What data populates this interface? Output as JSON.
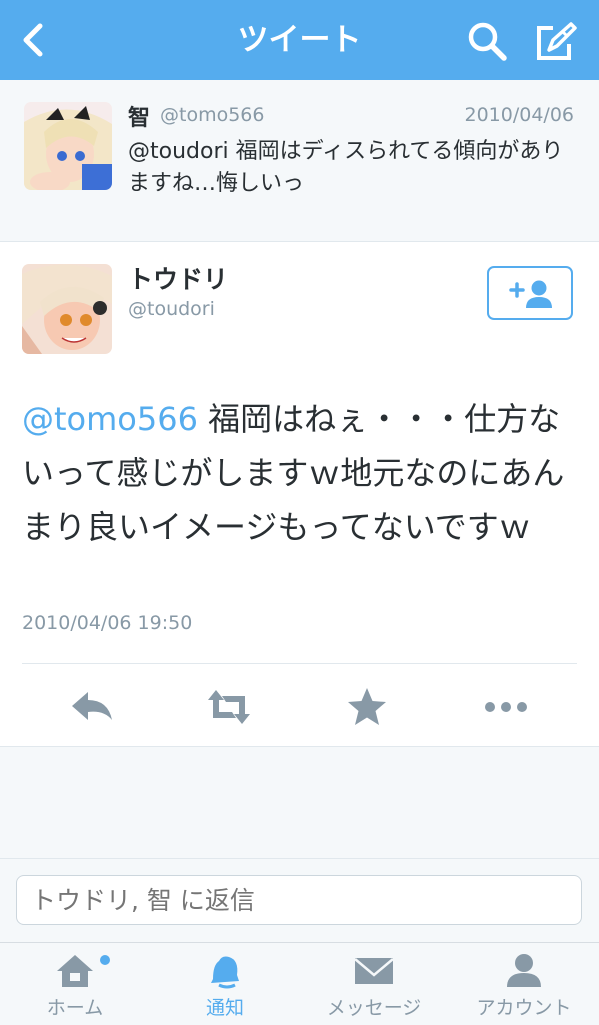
{
  "nav": {
    "title": "ツイート",
    "back_icon": "chevron-left-icon",
    "search_icon": "search-icon",
    "compose_icon": "compose-icon",
    "color": "#55acee"
  },
  "parent_tweet": {
    "name": "智",
    "handle": "@tomo566",
    "date": "2010/04/06",
    "text": "@toudori 福岡はディスられてる傾向がありますね…悔しいっ"
  },
  "main_tweet": {
    "name": "トウドリ",
    "handle": "@toudori",
    "mention": "@tomo566",
    "text": " 福岡はねぇ・・・仕方ないって感じがしますｗ地元なのにあんまり良いイメージもってないですｗ",
    "timestamp": "2010/04/06 19:50",
    "follow_icon": "add-user-icon",
    "actions": [
      "reply-icon",
      "retweet-icon",
      "favorite-icon",
      "more-icon"
    ]
  },
  "reply": {
    "placeholder": "トウドリ, 智 に返信"
  },
  "tabs": [
    {
      "label": "ホーム",
      "icon": "home-icon"
    },
    {
      "label": "通知",
      "icon": "bell-icon",
      "active": true
    },
    {
      "label": "メッセージ",
      "icon": "envelope-icon"
    },
    {
      "label": "アカウント",
      "icon": "person-icon"
    }
  ]
}
